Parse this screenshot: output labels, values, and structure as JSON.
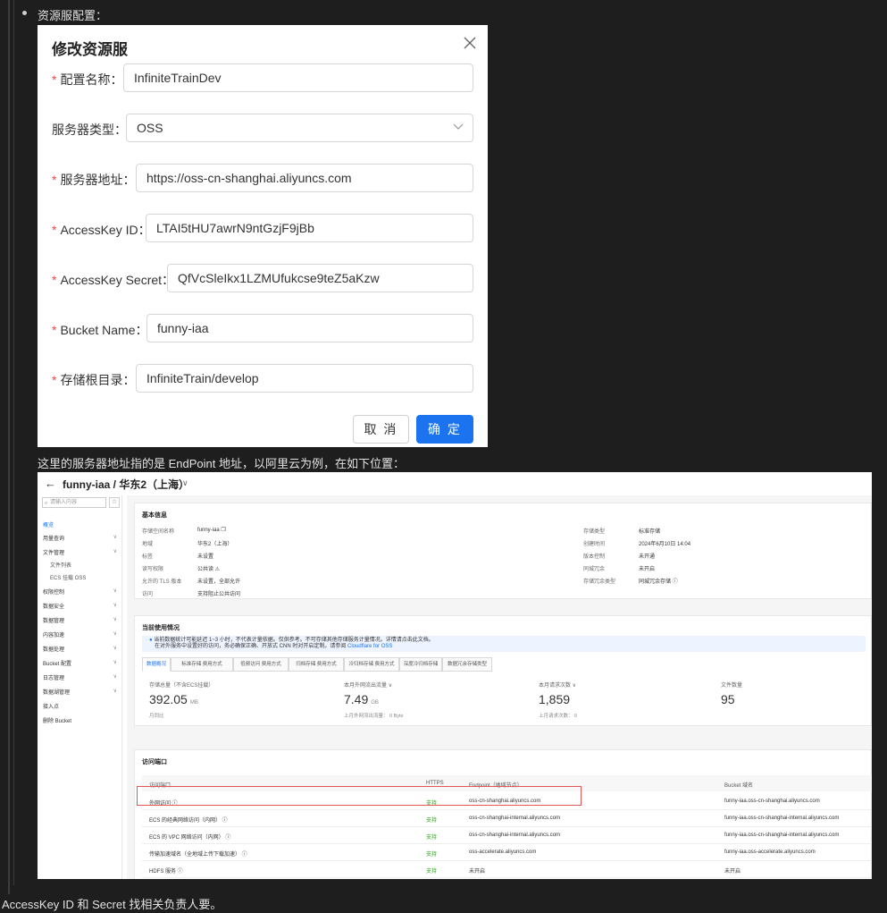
{
  "doc": {
    "heading": "资源服配置：",
    "line2": "这里的服务器地址指的是 EndPoint 地址，以阿里云为例，在如下位置：",
    "line3": "AccessKey ID 和 Secret 找相关负责人要。"
  },
  "dialog": {
    "title": "修改资源服",
    "fields": [
      {
        "label": "配置名称：",
        "required": true,
        "value": "InfiniteTrainDev"
      },
      {
        "label": "服务器类型：",
        "required": false,
        "value": "OSS"
      },
      {
        "label": "服务器地址：",
        "required": true,
        "value": "https://oss-cn-shanghai.aliyuncs.com"
      },
      {
        "label": "AccessKey ID：",
        "required": true,
        "value": "LTAI5tHU7awrN9ntGzjF9jBb"
      },
      {
        "label": "AccessKey Secret：",
        "required": true,
        "value": "QfVcSleIkx1LZMUfukcse9teZ5aKzw"
      },
      {
        "label": "Bucket Name：",
        "required": true,
        "value": "funny-iaa"
      },
      {
        "label": "存储根目录：",
        "required": true,
        "value": "InfiniteTrain/develop"
      }
    ],
    "required_mark": "*",
    "cancel_label": "取 消",
    "ok_label": "确 定"
  },
  "oss": {
    "back": "←",
    "bucket_title": "funny-iaa / 华东2（上海）",
    "chevron": "∨",
    "search_placeholder": "请输入内容",
    "star": "☆",
    "sidebar": [
      {
        "label": "概览",
        "active": true,
        "sub": false,
        "caret": false
      },
      {
        "label": "用量查询",
        "active": false,
        "sub": false,
        "caret": true
      },
      {
        "label": "文件管理",
        "active": false,
        "sub": false,
        "caret": true
      },
      {
        "label": "文件列表",
        "active": false,
        "sub": true,
        "caret": false
      },
      {
        "label": "ECS 挂载 OSS",
        "active": false,
        "sub": true,
        "caret": false
      },
      {
        "label": "权限控制",
        "active": false,
        "sub": false,
        "caret": true
      },
      {
        "label": "数据安全",
        "active": false,
        "sub": false,
        "caret": true
      },
      {
        "label": "数据管理",
        "active": false,
        "sub": false,
        "caret": true
      },
      {
        "label": "内容加速",
        "active": false,
        "sub": false,
        "caret": true
      },
      {
        "label": "数据处理",
        "active": false,
        "sub": false,
        "caret": true
      },
      {
        "label": "Bucket 配置",
        "active": false,
        "sub": false,
        "caret": true
      },
      {
        "label": "日志管理",
        "active": false,
        "sub": false,
        "caret": true
      },
      {
        "label": "数据湖管理",
        "active": false,
        "sub": false,
        "caret": true
      },
      {
        "label": "接入点",
        "active": false,
        "sub": false,
        "caret": false
      },
      {
        "label": "删除 Bucket",
        "active": false,
        "sub": false,
        "caret": false
      }
    ],
    "basic": {
      "title": "基本信息",
      "left": [
        {
          "k": "存储空间名称",
          "v": "funny-iaa ❐"
        },
        {
          "k": "地域",
          "v": "华东2（上海）"
        },
        {
          "k": "标签",
          "v": "未设置"
        },
        {
          "k": "读写权限",
          "v": "公共读 ⚠"
        },
        {
          "k": "允许的 TLS 版本",
          "v": "未设置，全部允许"
        },
        {
          "k": "访问",
          "v": "支持阻止公共访问"
        }
      ],
      "right": [
        {
          "k": "存储类型",
          "v": "标准存储"
        },
        {
          "k": "创建时间",
          "v": "2024年6月10日 14:04"
        },
        {
          "k": "版本控制",
          "v": "未开通"
        },
        {
          "k": "同城冗余",
          "v": "未开启"
        },
        {
          "k": "存储冗余类型",
          "v": "同城冗余存储 ⓘ"
        }
      ]
    },
    "usage": {
      "title": "当前使用情况",
      "info_line1": "当前数据统计可能延迟 1~3 小时，不代表计量依据。仅供参考。不可存储其他存储服务计量情况。详情请点击此文档。",
      "info_line2": "在对外服务中设置好的访问，务必确保正确、开放式 CNN 时对开启定制。请参阅",
      "info_link": "Cloudflare for OSS",
      "tabs": [
        "数据概况",
        "标准存储 费用方式",
        "低频访问 费用方式",
        "归档存储 费用方式",
        "冷归档存储 费用方式",
        "深度冷归档存储",
        "数据冗余存储类型"
      ],
      "stats": [
        {
          "label": "存储总量（不含ECS挂载）",
          "value": "392.05",
          "unit": "MB",
          "sub": "月同比"
        },
        {
          "label": "本月外网流出流量 ∨",
          "value": "7.49",
          "unit": "GB",
          "sub": "上月外网流出流量： 0 Byte"
        },
        {
          "label": "本月请求次数 ∨",
          "value": "1,859",
          "unit": "",
          "sub": "上月请求次数： 0"
        },
        {
          "label": "文件数量",
          "value": "95",
          "unit": "",
          "sub": ""
        }
      ]
    },
    "access": {
      "title": "访问端口",
      "headers": [
        "访问端口",
        "HTTPS",
        "Endpoint（地域节点）",
        "Bucket 域名"
      ],
      "rows": [
        {
          "port": "外网访问 ⓘ",
          "https": "支持",
          "endpoint": "oss-cn-shanghai.aliyuncs.com",
          "domain": "funny-iaa.oss-cn-shanghai.aliyuncs.com"
        },
        {
          "port": "ECS 的经典网络访问（内网） ⓘ",
          "https": "支持",
          "endpoint": "oss-cn-shanghai-internal.aliyuncs.com",
          "domain": "funny-iaa.oss-cn-shanghai-internal.aliyuncs.com"
        },
        {
          "port": "ECS 的 VPC 网络访问（内网） ⓘ",
          "https": "支持",
          "endpoint": "oss-cn-shanghai-internal.aliyuncs.com",
          "domain": "funny-iaa.oss-cn-shanghai-internal.aliyuncs.com"
        },
        {
          "port": "传输加速域名（全地域上传下载加速） ⓘ",
          "https": "支持",
          "endpoint": "oss-accelerate.aliyuncs.com",
          "domain": "funny-iaa.oss-accelerate.aliyuncs.com"
        },
        {
          "port": "HDFS 服务 ⓘ",
          "https": "支持",
          "endpoint": "未开启",
          "domain": "未开启"
        }
      ]
    }
  },
  "colors": {
    "primary": "#1b73f0",
    "required": "#e8483e",
    "success": "#2aa515",
    "highlight": "#e45656",
    "page_bg": "#1e1e1e"
  }
}
